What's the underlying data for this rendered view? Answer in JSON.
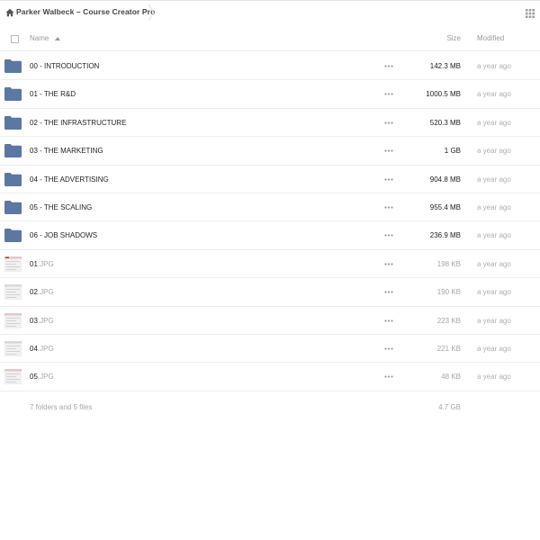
{
  "breadcrumb": {
    "title": "Parker Walbeck – Course Creator Pro"
  },
  "header": {
    "name_label": "Name",
    "size_label": "Size",
    "modified_label": "Modified"
  },
  "rows": [
    {
      "kind": "folder",
      "name": "00 - INTRODUCTION",
      "ext": "",
      "size": "142.3 MB",
      "modified": "a year ago"
    },
    {
      "kind": "folder",
      "name": "01 - THE R&D",
      "ext": "",
      "size": "1000.5 MB",
      "modified": "a year ago"
    },
    {
      "kind": "folder",
      "name": "02 - THE INFRASTRUCTURE",
      "ext": "",
      "size": "520.3 MB",
      "modified": "a year ago"
    },
    {
      "kind": "folder",
      "name": "03 - THE MARKETING",
      "ext": "",
      "size": "1 GB",
      "modified": "a year ago"
    },
    {
      "kind": "folder",
      "name": "04 - THE ADVERTISING",
      "ext": "",
      "size": "904.8 MB",
      "modified": "a year ago"
    },
    {
      "kind": "folder",
      "name": "05 - THE SCALING",
      "ext": "",
      "size": "955.4 MB",
      "modified": "a year ago"
    },
    {
      "kind": "folder",
      "name": "06 - JOB SHADOWS",
      "ext": "",
      "size": "236.9 MB",
      "modified": "a year ago"
    },
    {
      "kind": "file",
      "name": "01",
      "ext": ".JPG",
      "size": "198 KB",
      "modified": "a year ago"
    },
    {
      "kind": "file",
      "name": "02",
      "ext": ".JPG",
      "size": "190 KB",
      "modified": "a year ago"
    },
    {
      "kind": "file",
      "name": "03",
      "ext": ".JPG",
      "size": "223 KB",
      "modified": "a year ago"
    },
    {
      "kind": "file",
      "name": "04",
      "ext": ".JPG",
      "size": "221 KB",
      "modified": "a year ago"
    },
    {
      "kind": "file",
      "name": "05",
      "ext": ".JPG",
      "size": "48 KB",
      "modified": "a year ago"
    }
  ],
  "summary": {
    "counts": "7 folders and 5 files",
    "total_size": "4.7 GB"
  },
  "colors": {
    "folder": "#5b77a4",
    "row_border": "#ededed",
    "muted_text": "#a6a6a6",
    "thumb_accent": "#c0392b"
  },
  "icons": {
    "home": "home-icon",
    "folder": "folder-icon",
    "more": "more-actions-icon",
    "grid": "grid-view-icon",
    "sort": "sort-ascending-icon"
  }
}
